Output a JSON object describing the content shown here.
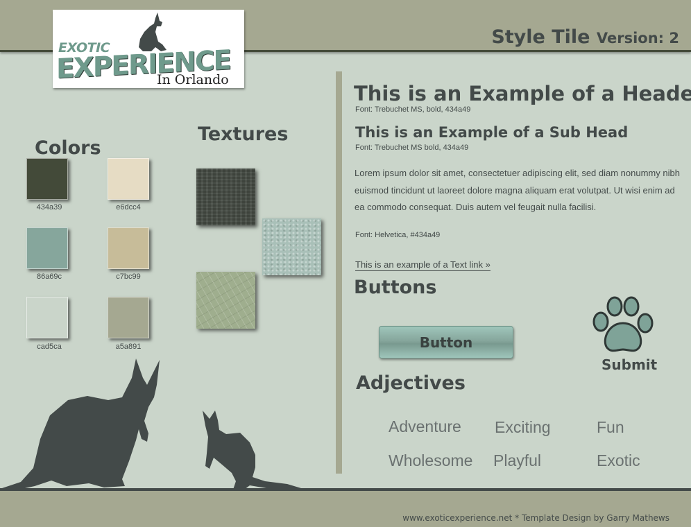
{
  "header": {
    "title": "Style Tile",
    "version": "Version: 2"
  },
  "logo": {
    "line1": "EXOTIC",
    "line2": "EXPERIENCE",
    "line3": "In Orlando"
  },
  "colors": {
    "title": "Colors",
    "swatches": [
      {
        "hex": "#434a39",
        "label": "434a39"
      },
      {
        "hex": "#e6dcc4",
        "label": "e6dcc4"
      },
      {
        "hex": "#86a69c",
        "label": "86a69c"
      },
      {
        "hex": "#c7bc99",
        "label": "c7bc99"
      },
      {
        "hex": "#cad5ca",
        "label": "cad5ca"
      },
      {
        "hex": "#a5a891",
        "label": "a5a891"
      }
    ]
  },
  "textures": {
    "title": "Textures"
  },
  "typography": {
    "header": "This is an Example of a Header",
    "header_note": "Font: Trebuchet MS, bold, 434a49",
    "subhead": "This is an Example of a Sub Head",
    "subhead_note": "Font: Trebuchet MS bold, 434a49",
    "body": "Lorem ipsum dolor sit amet, consectetuer adipiscing elit, sed diam nonummy nibh euismod tincidunt ut laoreet dolore magna aliquam erat volutpat. Ut wisi enim ad  ea commodo consequat. Duis autem vel feugait nulla facilisi.",
    "body_note": "Font: Helvetica, #434a49",
    "link": "This is an example of a Text link »"
  },
  "buttons": {
    "title": "Buttons",
    "button_label": "Button",
    "submit_label": "Submit"
  },
  "adjectives": {
    "title": "Adjectives",
    "words": [
      "Adventure",
      "Exciting",
      "Fun",
      "Wholesome",
      "Playful",
      "Exotic"
    ]
  },
  "footer": {
    "text": "www.exoticexperience.net * Template Design by Garry Mathews"
  },
  "palette": {
    "background": "#cad5ca",
    "bar": "#a5a891",
    "text": "#434a49"
  }
}
